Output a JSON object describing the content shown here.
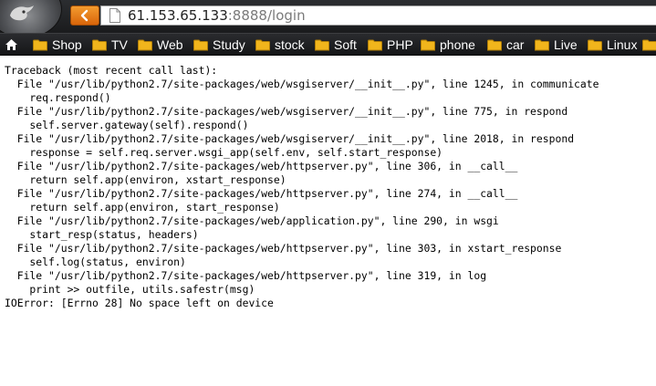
{
  "browser": {
    "address_bar": {
      "host": "61.153.65.133",
      "rest": ":8888/login"
    },
    "bookmarks": [
      {
        "label": "Shop"
      },
      {
        "label": "TV"
      },
      {
        "label": "Web"
      },
      {
        "label": "Study"
      },
      {
        "label": "stock"
      },
      {
        "label": "Soft"
      },
      {
        "label": "PHP"
      },
      {
        "label": "phone"
      },
      {
        "label": "car"
      },
      {
        "label": "Live"
      },
      {
        "label": "Linux"
      }
    ],
    "colors": {
      "back_button": "#e97a16",
      "bookmark_bar": "#1f2022",
      "folder": "#f1b51c"
    },
    "icons": [
      "app-orb-icon",
      "back-arrow-icon",
      "page-icon",
      "home-icon",
      "folder-icon"
    ]
  },
  "traceback": {
    "lines": [
      "Traceback (most recent call last):",
      "  File \"/usr/lib/python2.7/site-packages/web/wsgiserver/__init__.py\", line 1245, in communicate",
      "    req.respond()",
      "  File \"/usr/lib/python2.7/site-packages/web/wsgiserver/__init__.py\", line 775, in respond",
      "    self.server.gateway(self).respond()",
      "  File \"/usr/lib/python2.7/site-packages/web/wsgiserver/__init__.py\", line 2018, in respond",
      "    response = self.req.server.wsgi_app(self.env, self.start_response)",
      "  File \"/usr/lib/python2.7/site-packages/web/httpserver.py\", line 306, in __call__",
      "    return self.app(environ, xstart_response)",
      "  File \"/usr/lib/python2.7/site-packages/web/httpserver.py\", line 274, in __call__",
      "    return self.app(environ, start_response)",
      "  File \"/usr/lib/python2.7/site-packages/web/application.py\", line 290, in wsgi",
      "    start_resp(status, headers)",
      "  File \"/usr/lib/python2.7/site-packages/web/httpserver.py\", line 303, in xstart_response",
      "    self.log(status, environ)",
      "  File \"/usr/lib/python2.7/site-packages/web/httpserver.py\", line 319, in log",
      "    print >> outfile, utils.safestr(msg)",
      "IOError: [Errno 28] No space left on device"
    ]
  }
}
